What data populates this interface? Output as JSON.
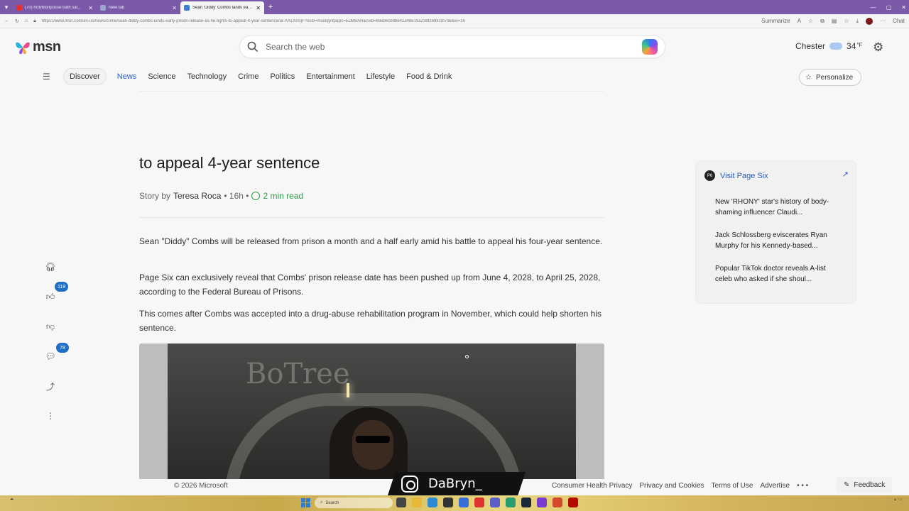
{
  "browser": {
    "tabs": [
      {
        "title": "(70) hrdvblonposse bath sal...",
        "favicon_color": "#e4312b"
      },
      {
        "title": "New tab",
        "favicon_color": "#9aa8c8"
      },
      {
        "title": "Sean 'Diddy' Combs lands early p...",
        "favicon_color": "#3a7bd5"
      }
    ],
    "new_tab": "+",
    "url": "https://www.msn.com/en-us/news/crime/sean-diddy-combs-lands-early-prison-release-as-he-fights-to-appeal-4-year-sentence/ar-AA1XnSjF?ocid=msedgntp&pc=EDBBAN&cvid=69eb6cb8b641348e19a238f26fb01b7de&ei=16",
    "summarize_label": "Summarize",
    "chat_label": "Chat"
  },
  "header": {
    "logo_text": "msn",
    "search_placeholder": "Search the web",
    "weather_city": "Chester",
    "weather_temp": "34",
    "weather_unit": "°F",
    "personalize_label": "Personalize"
  },
  "nav": {
    "items": [
      "Discover",
      "News",
      "Science",
      "Technology",
      "Crime",
      "Politics",
      "Entertainment",
      "Lifestyle",
      "Food & Drink"
    ]
  },
  "article": {
    "headline": "to appeal 4-year sentence",
    "story_by": "Story by",
    "author": "Teresa Roca",
    "age": "• 16h •",
    "read_time": "2 min read",
    "paragraphs": [
      "Sean \"Diddy\" Combs will be released from prison a month and a half early amid his battle to appeal his four-year sentence.",
      "Page Six can exclusively reveal that Combs' prison release date has been pushed up from June 4, 2028, to April 25, 2028, according to the Federal Bureau of Prisons.",
      "This comes after Combs was accepted into a drug-abuse rehabilitation program in November, which could help shorten his sentence."
    ],
    "photo_sign": "BoTree"
  },
  "rail": {
    "like_count": "119",
    "comment_count": "78"
  },
  "side_card": {
    "source_logo": "P6",
    "title": "Visit Page Six",
    "stories": [
      "New 'RHONY' star's history of body-shaming influencer Claudi...",
      "Jack Schlossberg eviscerates Ryan Murphy for his Kennedy-based...",
      "Popular TikTok doctor reveals A-list celeb who asked if she shoul..."
    ]
  },
  "footer": {
    "copyright": "© 2026 Microsoft",
    "links": [
      "Consumer Health Privacy",
      "Privacy and Cookies",
      "Terms of Use",
      "Advertise",
      "• • •"
    ],
    "feedback_label": "Feedback"
  },
  "overlay": {
    "handle": "DaBryn_"
  },
  "taskbar": {
    "search_label": "Search"
  },
  "colors": {
    "accent": "#1f5fd4",
    "tabbar": "#7a5aa8",
    "read_time": "#2f9a49",
    "badge": "#1f6fc8"
  }
}
